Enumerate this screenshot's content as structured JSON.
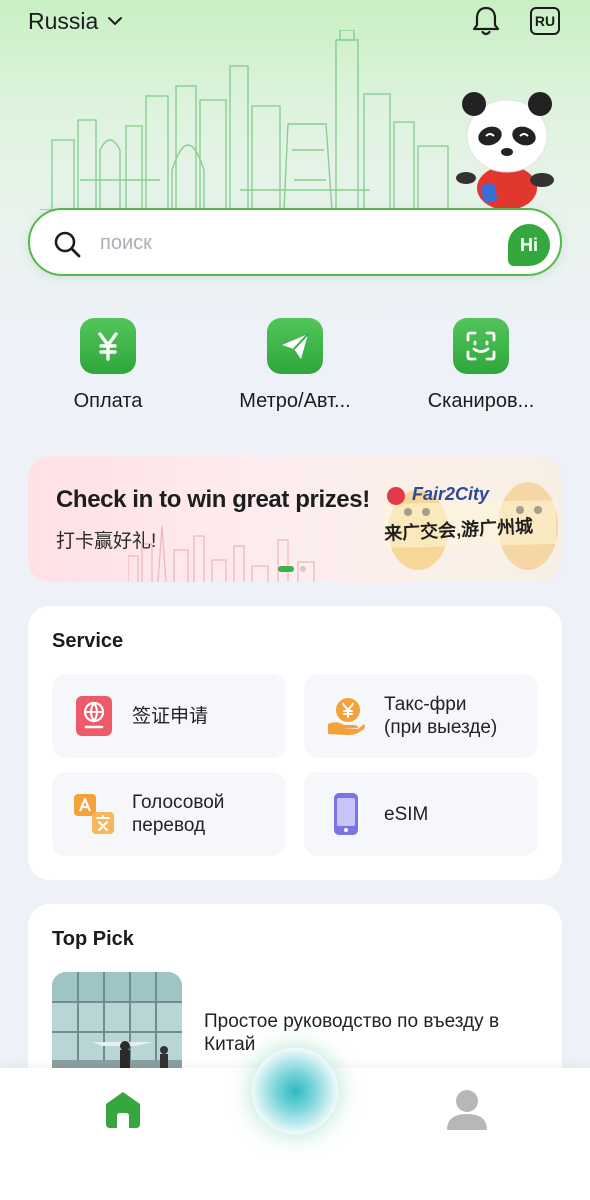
{
  "header": {
    "region": "Russia",
    "language_badge": "RU"
  },
  "search": {
    "placeholder": "поиск",
    "assistant_label": "Hi"
  },
  "quick_actions": [
    {
      "label": "Оплата",
      "icon": "yuan-icon"
    },
    {
      "label": "Метро/Авт...",
      "icon": "paper-plane-icon"
    },
    {
      "label": "Сканиров...",
      "icon": "scan-icon"
    }
  ],
  "banner": {
    "title": "Check in to win great prizes!",
    "subtitle": "打卡赢好礼!",
    "brand": "Fair2City",
    "slogan": "来广交会,游广州城",
    "slides_total": 2,
    "slide_active": 1
  },
  "service": {
    "title": "Service",
    "items": [
      {
        "label": "签证申请",
        "icon": "visa-passport-icon",
        "color": "#ef5a6b"
      },
      {
        "label": "Такс-фри\n(при выезде)",
        "icon": "tax-refund-icon",
        "color": "#f5a23a"
      },
      {
        "label": "Голосовой\nперевод",
        "icon": "translate-icon",
        "color": "#f5a23a"
      },
      {
        "label": "eSIM",
        "icon": "esim-phone-icon",
        "color": "#7b74e6"
      }
    ]
  },
  "top_pick": {
    "title": "Top Pick",
    "article_title": "Простое руководство по въезду в Китай"
  },
  "colors": {
    "accent": "#34a83c",
    "background": "#eef1f8"
  }
}
